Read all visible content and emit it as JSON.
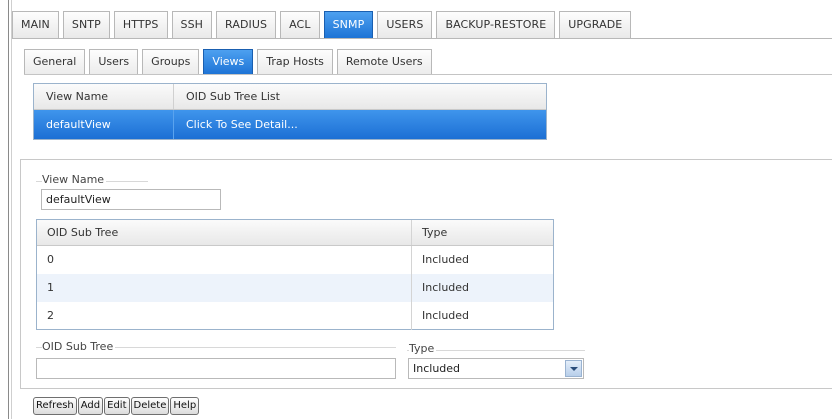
{
  "top_tabs": [
    {
      "label": "MAIN",
      "active": false
    },
    {
      "label": "SNTP",
      "active": false
    },
    {
      "label": "HTTPS",
      "active": false
    },
    {
      "label": "SSH",
      "active": false
    },
    {
      "label": "RADIUS",
      "active": false
    },
    {
      "label": "ACL",
      "active": false
    },
    {
      "label": "SNMP",
      "active": true
    },
    {
      "label": "USERS",
      "active": false
    },
    {
      "label": "BACKUP-RESTORE",
      "active": false
    },
    {
      "label": "UPGRADE",
      "active": false
    }
  ],
  "sub_tabs": [
    {
      "label": "General",
      "active": false
    },
    {
      "label": "Users",
      "active": false
    },
    {
      "label": "Groups",
      "active": false
    },
    {
      "label": "Views",
      "active": true
    },
    {
      "label": "Trap Hosts",
      "active": false
    },
    {
      "label": "Remote Users",
      "active": false
    }
  ],
  "view_list": {
    "columns": [
      "View Name",
      "OID Sub Tree List"
    ],
    "rows": [
      {
        "name": "defaultView",
        "detail": "Click To See Detail...",
        "selected": true
      }
    ]
  },
  "detail": {
    "view_name_label": "View Name",
    "view_name_value": "defaultView",
    "oid_table": {
      "columns": [
        "OID Sub Tree",
        "Type"
      ],
      "rows": [
        {
          "oid": "0",
          "type": "Included"
        },
        {
          "oid": "1",
          "type": "Included"
        },
        {
          "oid": "2",
          "type": "Included"
        }
      ]
    },
    "oid_field_label": "OID Sub Tree",
    "oid_field_value": "",
    "type_label": "Type",
    "type_selected": "Included"
  },
  "buttons": {
    "refresh": "Refresh",
    "add": "Add",
    "edit": "Edit",
    "delete": "Delete",
    "help": "Help"
  },
  "colors": {
    "accent": "#1e74d6",
    "alt_row": "#edf3fb"
  }
}
